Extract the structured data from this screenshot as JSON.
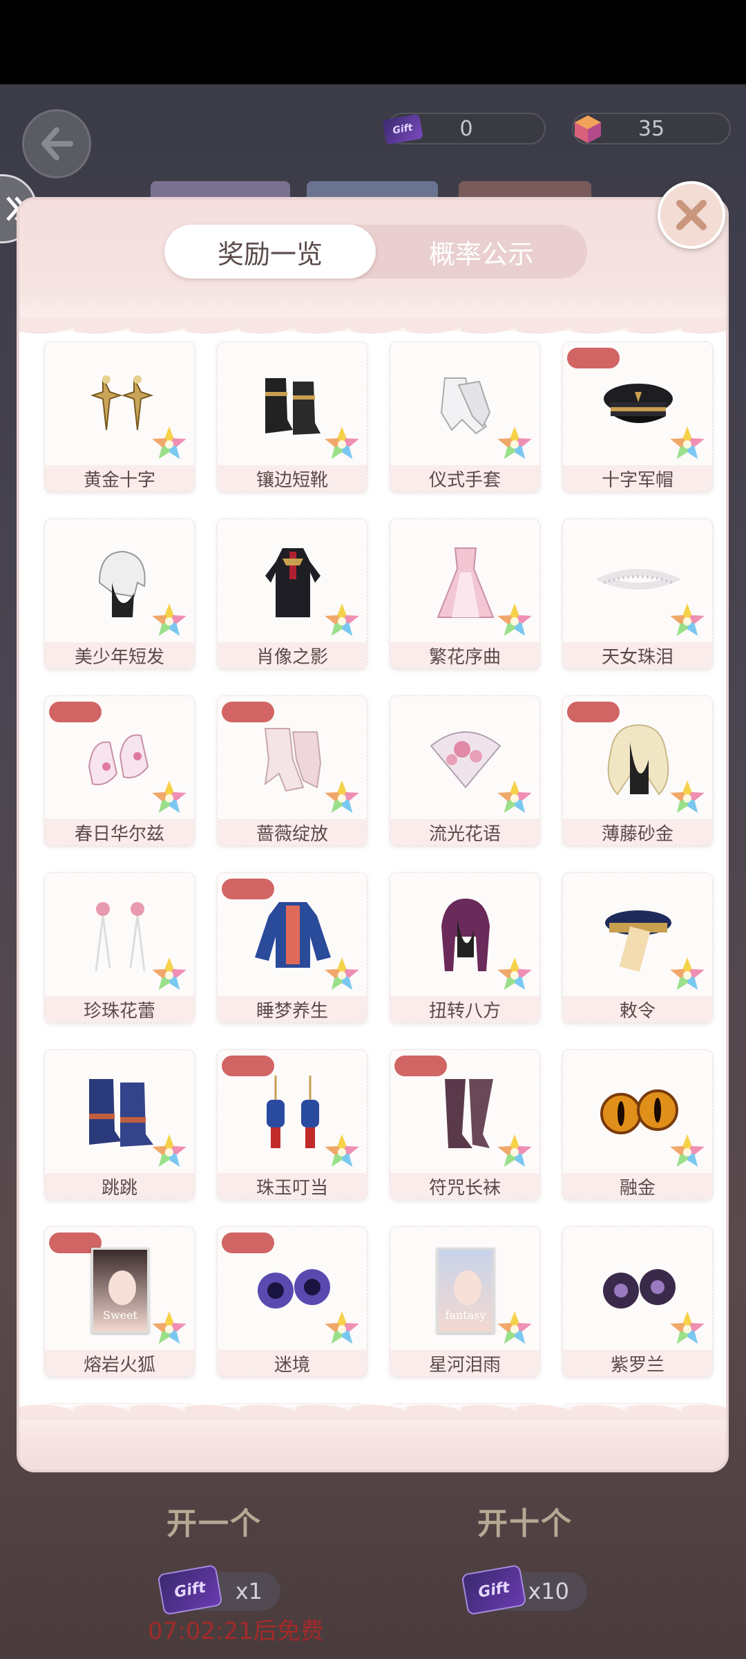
{
  "currency": {
    "tickets": "0",
    "gems": "35",
    "ticket_icon_text": "Gift"
  },
  "modal": {
    "tabs": [
      {
        "label": "奖励一览",
        "active": true
      },
      {
        "label": "概率公示",
        "active": false
      }
    ],
    "items": [
      {
        "name": "黄金十字",
        "tag": false,
        "icon": "gold-cross-earrings"
      },
      {
        "name": "镶边短靴",
        "tag": false,
        "icon": "black-boots"
      },
      {
        "name": "仪式手套",
        "tag": false,
        "icon": "white-gloves"
      },
      {
        "name": "十字军帽",
        "tag": true,
        "icon": "military-cap"
      },
      {
        "name": "美少年短发",
        "tag": false,
        "icon": "short-hair"
      },
      {
        "name": "肖像之影",
        "tag": false,
        "icon": "dark-coat-outfit"
      },
      {
        "name": "繁花序曲",
        "tag": false,
        "icon": "pink-dress"
      },
      {
        "name": "天女珠泪",
        "tag": false,
        "icon": "pearl-headband"
      },
      {
        "name": "春日华尔兹",
        "tag": true,
        "icon": "pink-shoes"
      },
      {
        "name": "蔷薇绽放",
        "tag": true,
        "icon": "lace-gloves"
      },
      {
        "name": "流光花语",
        "tag": false,
        "icon": "floral-fan"
      },
      {
        "name": "薄藤砂金",
        "tag": true,
        "icon": "blonde-hair"
      },
      {
        "name": "珍珠花蕾",
        "tag": false,
        "icon": "pearl-earrings"
      },
      {
        "name": "睡梦养生",
        "tag": true,
        "icon": "blue-jacket"
      },
      {
        "name": "扭转八方",
        "tag": false,
        "icon": "braided-hair"
      },
      {
        "name": "敕令",
        "tag": false,
        "icon": "talisman-hat"
      },
      {
        "name": "跳跳",
        "tag": false,
        "icon": "blue-boots"
      },
      {
        "name": "珠玉叮当",
        "tag": true,
        "icon": "lantern-earrings"
      },
      {
        "name": "符咒长袜",
        "tag": true,
        "icon": "stockings"
      },
      {
        "name": "融金",
        "tag": false,
        "icon": "gold-eyes"
      },
      {
        "name": "熔岩火狐",
        "tag": true,
        "icon": "face-card-sweet"
      },
      {
        "name": "迷境",
        "tag": true,
        "icon": "galaxy-eyes"
      },
      {
        "name": "星河泪雨",
        "tag": false,
        "icon": "face-card-fantasy"
      },
      {
        "name": "紫罗兰",
        "tag": false,
        "icon": "violet-eyes"
      }
    ],
    "face_card_texts": {
      "sweet": "Sweet",
      "fantasy": "fantasy"
    }
  },
  "bottom": {
    "open_one_label": "开一个",
    "open_ten_label": "开十个",
    "cost_one": "x1",
    "cost_ten": "x10",
    "timer_text": "07:02:21后免费"
  },
  "colors": {
    "tag_red": "#d06564",
    "modal_pink": "#f4dede",
    "timer_red": "#a32a2a"
  }
}
